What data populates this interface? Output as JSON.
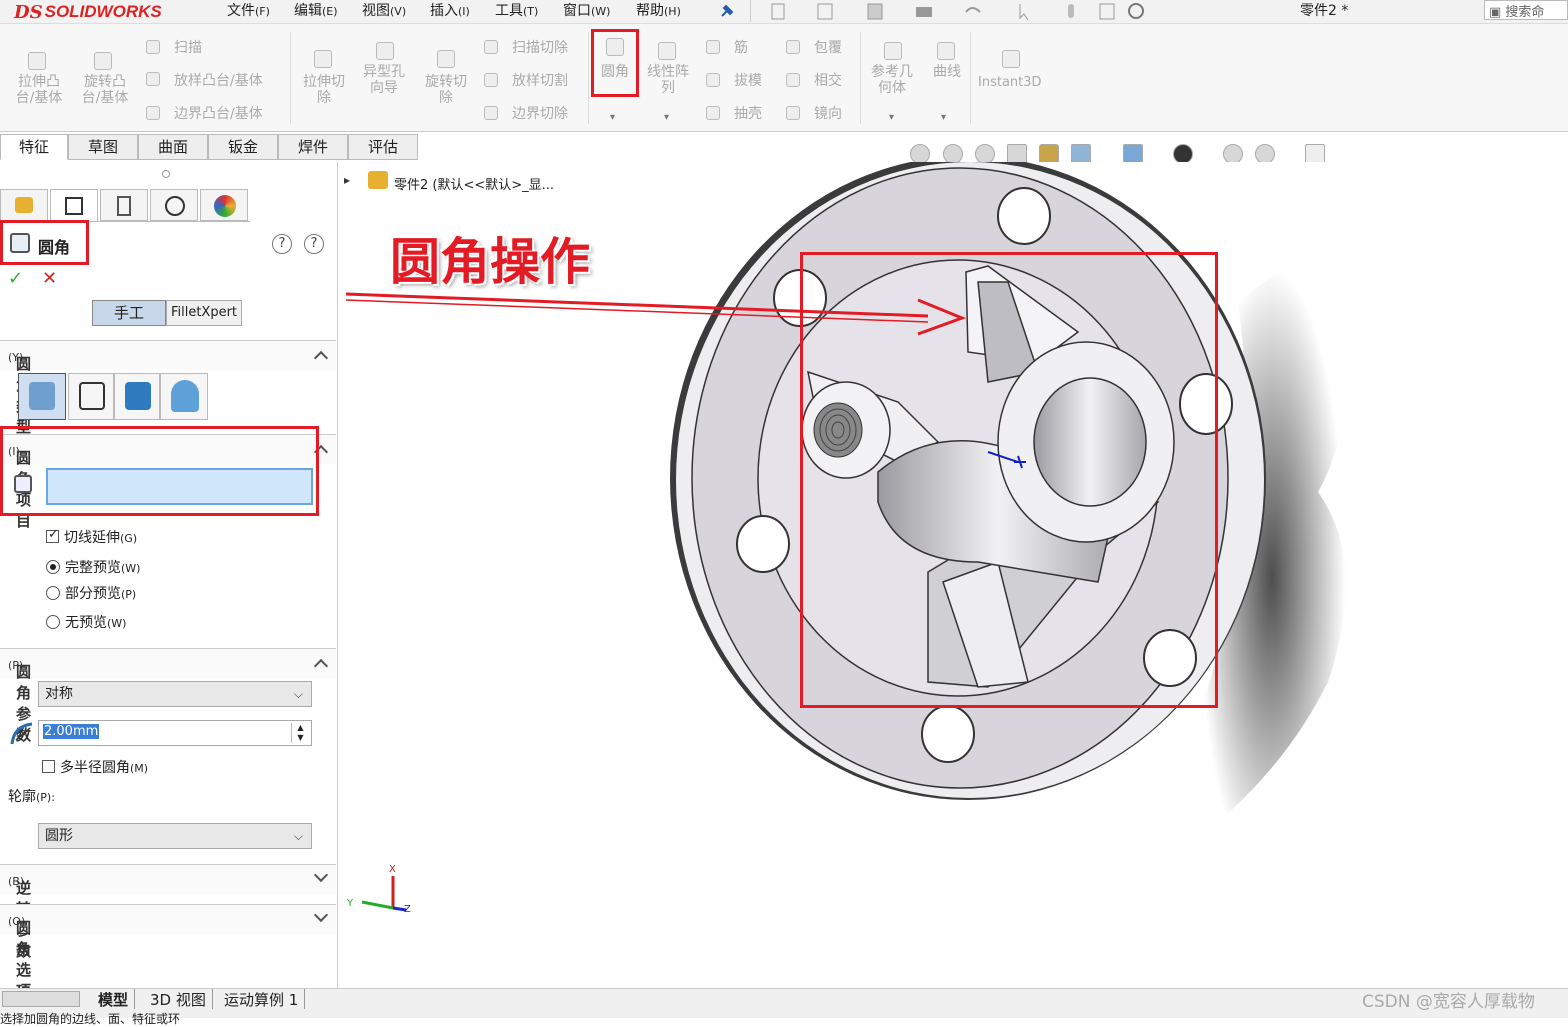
{
  "app": {
    "brand_ds": "DS",
    "brand_name": "SOLIDWORKS",
    "doc_title": "零件2 *",
    "search_label": "搜索命"
  },
  "menu": [
    {
      "label": "文件",
      "key": "(F)"
    },
    {
      "label": "编辑",
      "key": "(E)"
    },
    {
      "label": "视图",
      "key": "(V)"
    },
    {
      "label": "插入",
      "key": "(I)"
    },
    {
      "label": "工具",
      "key": "(T)"
    },
    {
      "label": "窗口",
      "key": "(W)"
    },
    {
      "label": "帮助",
      "key": "(H)"
    }
  ],
  "commands": {
    "extrude_boss": "拉伸凸台/基体",
    "revolve_boss": "旋转凸台/基体",
    "sweep": "扫描",
    "loft_boss": "放样凸台/基体",
    "boundary_boss": "边界凸台/基体",
    "extrude_cut": "拉伸切除",
    "hole_wizard": "异型孔向导",
    "revolve_cut": "旋转切除",
    "sweep_cut": "扫描切除",
    "loft_cut": "放样切割",
    "boundary_cut": "边界切除",
    "fillet": "圆角",
    "linear_pattern": "线性阵列",
    "rib": "筋",
    "draft": "拔模",
    "shell": "抽壳",
    "wrap": "包覆",
    "intersect": "相交",
    "mirror": "镜向",
    "ref_geometry": "参考几何体",
    "curves": "曲线",
    "instant3d": "Instant3D"
  },
  "tabs": [
    "特征",
    "草图",
    "曲面",
    "钣金",
    "焊件",
    "评估"
  ],
  "tree": {
    "label": "零件2 (默认<<默认>_显..."
  },
  "panel": {
    "title": "圆角",
    "mode_manual": "手工",
    "mode_xpert": "FilletXpert",
    "section_type": {
      "label": "圆角类型",
      "key": "(Y)"
    },
    "section_items": {
      "label": "圆角项目",
      "key": "(I)"
    },
    "items_value": "",
    "tangent": {
      "label": "切线延伸",
      "key": "(G)",
      "checked": true
    },
    "full_preview": {
      "label": "完整预览",
      "key": "(W)",
      "selected": true
    },
    "partial_preview": {
      "label": "部分预览",
      "key": "(P)"
    },
    "no_preview": {
      "label": "无预览",
      "key": "(W)"
    },
    "section_params": {
      "label": "圆角参数",
      "key": "(P)"
    },
    "method": "对称",
    "radius": "2.00mm",
    "multi_radius": {
      "label": "多半径圆角",
      "key": "(M)",
      "checked": false
    },
    "profile_label": "轮廓",
    "profile_key": "(P):",
    "profile": "圆形",
    "section_setback": {
      "label": "逆转参数",
      "key": "(B)"
    },
    "section_options": {
      "label": "圆角选项",
      "key": "(O)"
    }
  },
  "annotation": {
    "text": "圆角操作",
    "color": "#e21b24"
  },
  "bottom_tabs": [
    "模型",
    "3D 视图",
    "运动算例 1"
  ],
  "status_text": "选择加圆角的边线、面、特征或环",
  "watermark": "CSDN @宽容人厚载物",
  "axis": {
    "x": "X",
    "y": "Y",
    "z": "Z"
  },
  "colors": {
    "accent": "#e21b24",
    "part_face": "#d8d4dc",
    "selection_fill": "#cfe6fb"
  }
}
